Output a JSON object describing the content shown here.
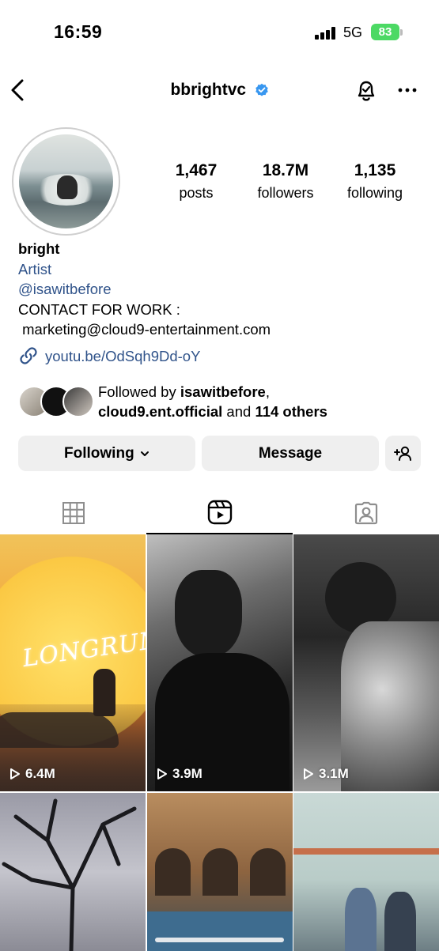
{
  "status_bar": {
    "time": "16:59",
    "network": "5G",
    "battery": "83"
  },
  "header": {
    "username": "bbrightvc"
  },
  "stats": [
    {
      "value": "1,467",
      "label": "posts"
    },
    {
      "value": "18.7M",
      "label": "followers"
    },
    {
      "value": "1,135",
      "label": "following"
    }
  ],
  "bio": {
    "name": "bright",
    "category": "Artist",
    "handle": "@isawitbefore",
    "line1": "CONTACT FOR WORK :",
    "line2": " marketing@cloud9-entertainment.com",
    "link": "youtu.be/OdSqh9Dd-oY"
  },
  "followed_by": {
    "prefix": "Followed by ",
    "user1": "isawitbefore",
    "sep": ",",
    "user2": "cloud9.ent.official",
    "and": " and ",
    "others": "114 others"
  },
  "buttons": {
    "following": "Following",
    "message": "Message"
  },
  "tabs": [
    "grid-tab",
    "reels-tab",
    "tagged-tab"
  ],
  "grid": [
    {
      "views": "6.4M",
      "title": "LONGRUN"
    },
    {
      "views": "3.9M"
    },
    {
      "views": "3.1M"
    },
    {},
    {},
    {}
  ],
  "colors": {
    "link": "#30538a",
    "button_bg": "#efefef",
    "battery": "#4cd964",
    "verified": "#3897f0"
  }
}
